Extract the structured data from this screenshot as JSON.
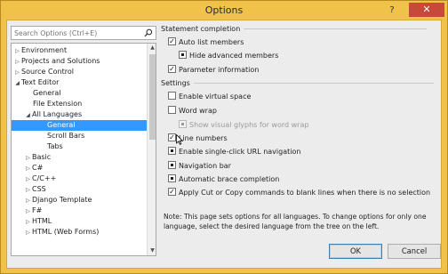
{
  "window": {
    "title": "Options",
    "help_label": "?",
    "close_label": "✕"
  },
  "search": {
    "placeholder": "Search Options (Ctrl+E)",
    "icon": "search-icon"
  },
  "tree": {
    "items": [
      {
        "label": "Environment",
        "arrow": "▷"
      },
      {
        "label": "Projects and Solutions",
        "arrow": "▷"
      },
      {
        "label": "Source Control",
        "arrow": "▷"
      },
      {
        "label": "Text Editor",
        "arrow": "◢"
      },
      {
        "label": "General",
        "arrow": ""
      },
      {
        "label": "File Extension",
        "arrow": ""
      },
      {
        "label": "All Languages",
        "arrow": "◢"
      },
      {
        "label": "General",
        "arrow": ""
      },
      {
        "label": "Scroll Bars",
        "arrow": ""
      },
      {
        "label": "Tabs",
        "arrow": ""
      },
      {
        "label": "Basic",
        "arrow": "▷"
      },
      {
        "label": "C#",
        "arrow": "▷"
      },
      {
        "label": "C/C++",
        "arrow": "▷"
      },
      {
        "label": "CSS",
        "arrow": "▷"
      },
      {
        "label": "Django Template",
        "arrow": "▷"
      },
      {
        "label": "F#",
        "arrow": "▷"
      },
      {
        "label": "HTML",
        "arrow": "▷"
      },
      {
        "label": "HTML (Web Forms)",
        "arrow": "▷"
      }
    ]
  },
  "statement_completion": {
    "heading": "Statement completion",
    "auto_list_members": "Auto list members",
    "hide_advanced_members": "Hide advanced members",
    "parameter_information": "Parameter information"
  },
  "settings": {
    "heading": "Settings",
    "enable_virtual_space": "Enable virtual space",
    "word_wrap": "Word wrap",
    "show_visual_glyphs": "Show visual glyphs for word wrap",
    "line_numbers": "Line numbers",
    "enable_single_click_url": "Enable single-click URL navigation",
    "navigation_bar": "Navigation bar",
    "automatic_brace_completion": "Automatic brace completion",
    "apply_cut_copy": "Apply Cut or Copy commands to blank lines when there is no selection"
  },
  "note": "Note: This page sets options for all languages. To change options for only one language, select the desired language from the tree on the left.",
  "buttons": {
    "ok": "OK",
    "cancel": "Cancel"
  },
  "colors": {
    "frame": "#f0c24a",
    "selection": "#3399ff",
    "close": "#c7493a"
  }
}
